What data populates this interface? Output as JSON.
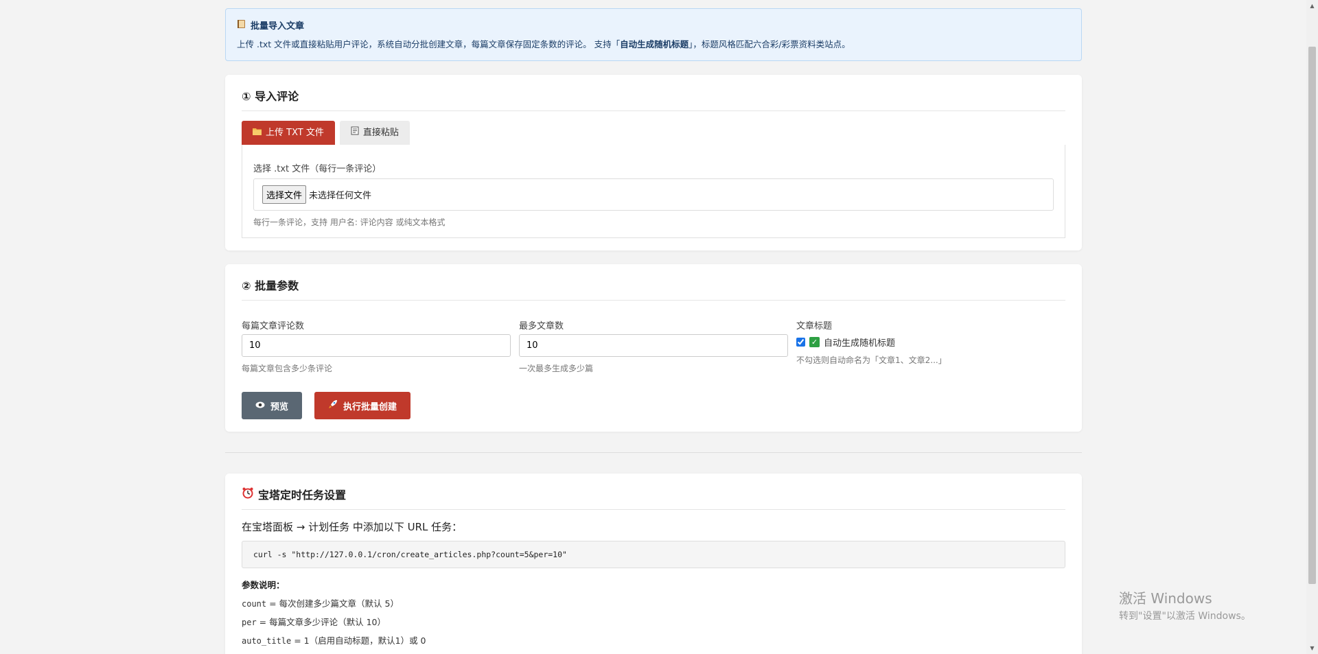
{
  "banner": {
    "icon": "book-icon",
    "title": "批量导入文章",
    "desc_pre": "上传 .txt 文件或直接粘贴用户评论，系统自动分批创建文章，每篇文章保存固定条数的评论。 支持「",
    "desc_bold": "自动生成随机标题",
    "desc_post": "」，标题风格匹配六合彩/彩票资料类站点。"
  },
  "import": {
    "title": "① 导入评论",
    "tab_upload": "上传 TXT 文件",
    "tab_paste": "直接粘贴",
    "file_label": "选择 .txt 文件（每行一条评论）",
    "file_button": "选择文件",
    "file_status": "未选择任何文件",
    "hint": "每行一条评论，支持 用户名: 评论内容 或纯文本格式"
  },
  "batch": {
    "title": "② 批量参数",
    "per_label": "每篇文章评论数",
    "per_value": "10",
    "per_hint": "每篇文章包含多少条评论",
    "max_label": "最多文章数",
    "max_value": "10",
    "max_hint": "一次最多生成多少篇",
    "title_label": "文章标题",
    "auto_title_label": "自动生成随机标题",
    "auto_title_checked": true,
    "title_hint": "不勾选则自动命名为「文章1、文章2...」",
    "preview_button": "预览",
    "run_button": "执行批量创建"
  },
  "cron": {
    "title": "宝塔定时任务设置",
    "intro": "在宝塔面板 → 计划任务 中添加以下 URL 任务：",
    "command": "curl -s \"http://127.0.0.1/cron/create_articles.php?count=5&per=10\"",
    "params_title": "参数说明：",
    "param1_key": "count",
    "param1_desc": " = 每次创建多少篇文章（默认 5）",
    "param2_key": "per",
    "param2_desc": " = 每篇文章多少评论（默认 10）",
    "param3_key": "auto_title",
    "param3_desc": " = 1（启用自动标题，默认1）或 0"
  },
  "watermark": {
    "title": "激活 Windows",
    "sub": "转到\"设置\"以激活 Windows。"
  },
  "colors": {
    "accent_red": "#c0392b",
    "gray_button": "#5a6773",
    "banner_bg": "#eaf3fd"
  }
}
